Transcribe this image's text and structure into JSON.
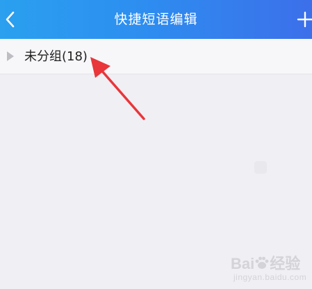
{
  "header": {
    "title": "快捷短语编辑",
    "back_icon": "chevron-left-icon",
    "add_icon": "plus-icon"
  },
  "group": {
    "label": "未分组(18)",
    "expand_icon": "triangle-right-icon"
  },
  "annotation": {
    "color": "#e8363a"
  },
  "watermark": {
    "brand": "Bai",
    "brand_tail": "经验",
    "site": "jingyan.baidu.com"
  },
  "colors": {
    "header_start": "#2aa0ef",
    "header_end": "#3c6fea",
    "background": "#efeff4",
    "row_background": "#f7f7f9"
  }
}
